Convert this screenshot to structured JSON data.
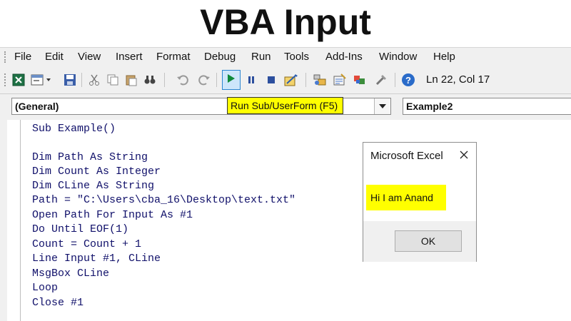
{
  "banner": {
    "title": "VBA Input"
  },
  "menu": {
    "items": [
      "File",
      "Edit",
      "View",
      "Insert",
      "Format",
      "Debug",
      "Run",
      "Tools",
      "Add-Ins",
      "Window",
      "Help"
    ]
  },
  "toolbar": {
    "icons": [
      "excel-icon",
      "insert-userform-icon",
      "save-icon",
      "cut-icon",
      "copy-icon",
      "paste-icon",
      "find-icon",
      "undo-icon",
      "redo-icon",
      "run-icon",
      "break-icon",
      "reset-icon",
      "design-mode-icon",
      "project-explorer-icon",
      "properties-icon",
      "object-browser-icon",
      "toolbox-icon",
      "help-icon"
    ],
    "position": "Ln 22, Col 17",
    "run_tooltip": "Run Sub/UserForm (F5)"
  },
  "combos": {
    "object": "(General)",
    "procedure": "Example2"
  },
  "code": {
    "lines": [
      "Sub Example()",
      "",
      "Dim Path As String",
      "Dim Count As Integer",
      "Dim CLine As String",
      "Path = \"C:\\Users\\cba_16\\Desktop\\text.txt\"",
      "Open Path For Input As #1",
      "Do Until EOF(1)",
      "Count = Count + 1",
      "Line Input #1, CLine",
      "MsgBox CLine",
      "Loop",
      "Close #1"
    ]
  },
  "msgbox": {
    "title": "Microsoft Excel",
    "message": "Hi I am Anand",
    "ok_label": "OK"
  },
  "colors": {
    "highlight": "#ffff00",
    "code_text": "#10106a",
    "toolbar_bg": "#f0f0f0"
  }
}
